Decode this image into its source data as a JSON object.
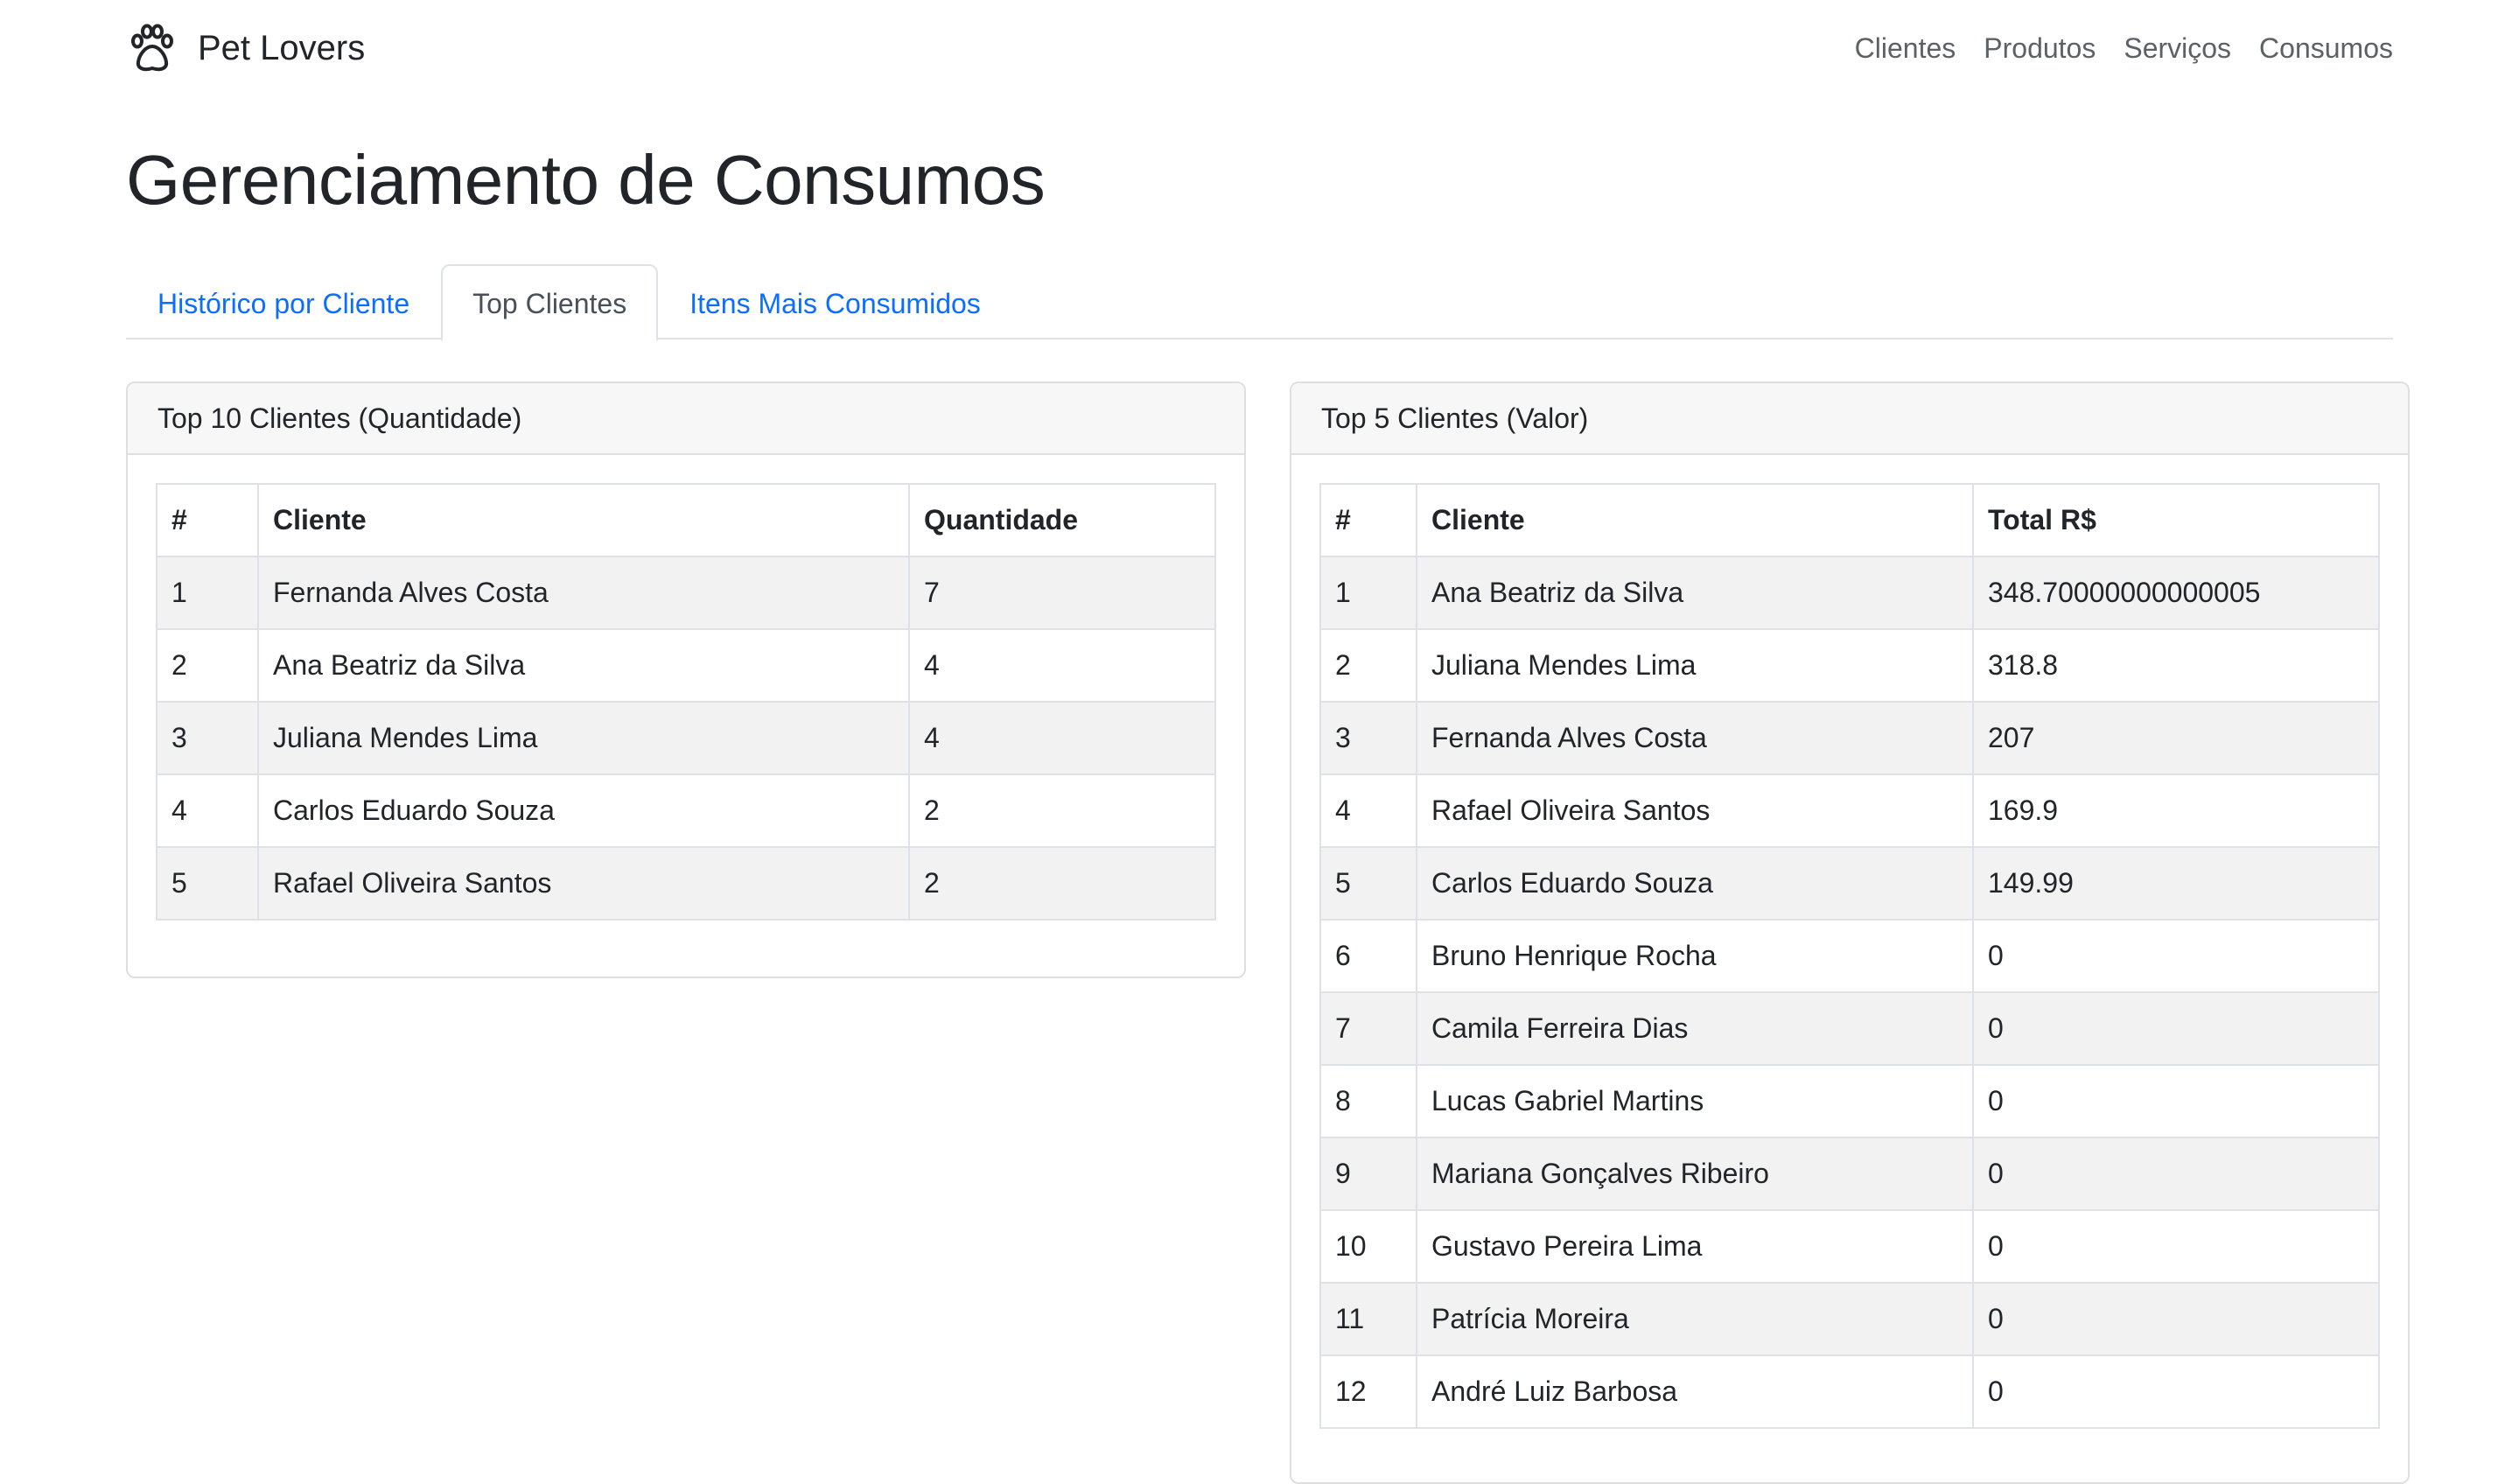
{
  "navbar": {
    "brand": "Pet Lovers",
    "brand_icon": "paw-icon",
    "links": [
      "Clientes",
      "Produtos",
      "Serviços",
      "Consumos"
    ]
  },
  "page": {
    "title": "Gerenciamento de Consumos"
  },
  "tabs": [
    {
      "label": "Histórico por Cliente",
      "active": false
    },
    {
      "label": "Top Clientes",
      "active": true
    },
    {
      "label": "Itens Mais Consumidos",
      "active": false
    }
  ],
  "top_quantidade": {
    "header": "Top 10 Clientes (Quantidade)",
    "columns": [
      "#",
      "Cliente",
      "Quantidade"
    ],
    "rows": [
      [
        "1",
        "Fernanda Alves Costa",
        "7"
      ],
      [
        "2",
        "Ana Beatriz da Silva",
        "4"
      ],
      [
        "3",
        "Juliana Mendes Lima",
        "4"
      ],
      [
        "4",
        "Carlos Eduardo Souza",
        "2"
      ],
      [
        "5",
        "Rafael Oliveira Santos",
        "2"
      ]
    ]
  },
  "top_valor": {
    "header": "Top 5 Clientes (Valor)",
    "columns": [
      "#",
      "Cliente",
      "Total R$"
    ],
    "rows": [
      [
        "1",
        "Ana Beatriz da Silva",
        "348.70000000000005"
      ],
      [
        "2",
        "Juliana Mendes Lima",
        "318.8"
      ],
      [
        "3",
        "Fernanda Alves Costa",
        "207"
      ],
      [
        "4",
        "Rafael Oliveira Santos",
        "169.9"
      ],
      [
        "5",
        "Carlos Eduardo Souza",
        "149.99"
      ],
      [
        "6",
        "Bruno Henrique Rocha",
        "0"
      ],
      [
        "7",
        "Camila Ferreira Dias",
        "0"
      ],
      [
        "8",
        "Lucas Gabriel Martins",
        "0"
      ],
      [
        "9",
        "Mariana Gonçalves Ribeiro",
        "0"
      ],
      [
        "10",
        "Gustavo Pereira Lima",
        "0"
      ],
      [
        "11",
        "Patrícia Moreira",
        "0"
      ],
      [
        "12",
        "André Luiz Barbosa",
        "0"
      ]
    ]
  },
  "colors": {
    "link": "#0d6efd",
    "nav_text": "#5c6166",
    "stripe": "#f2f2f2",
    "border": "#dee2e6"
  }
}
